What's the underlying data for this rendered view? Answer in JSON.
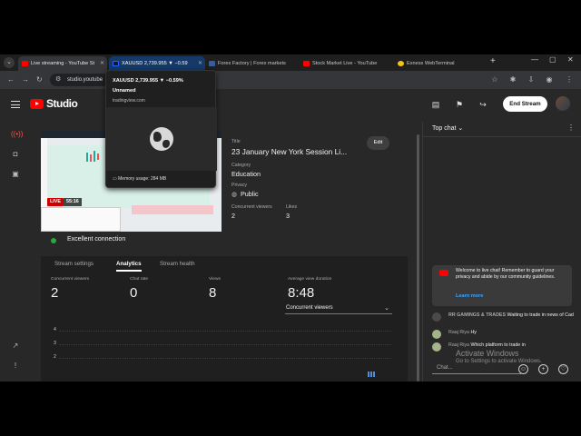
{
  "browser": {
    "tabs": [
      {
        "label": "Live streaming - YouTube St",
        "favicon_color": "#ff0000",
        "state": "active"
      },
      {
        "label": "XAUUSD 2,739.955 ▼ −0.59",
        "favicon_color": "#131722",
        "state": "hovered"
      },
      {
        "label": "Forex Factory | Forex markets",
        "favicon_color": "#3b5b9a",
        "state": "normal"
      },
      {
        "label": "Stock Market Live - YouTube",
        "favicon_color": "#ff0000",
        "state": "normal"
      },
      {
        "label": "Exness WebTerminal",
        "favicon_color": "#f3c316",
        "state": "normal"
      }
    ],
    "url": "studio.youtube",
    "hover_card": {
      "title": "XAUUSD 2,739.955 ▼ −0.59%",
      "subtitle": "Unnamed",
      "domain": "tradingview.com",
      "memory": "Memory usage: 284 MB"
    }
  },
  "studio": {
    "brand": "Studio",
    "end_stream_label": "End Stream",
    "stream": {
      "live_badge": "LIVE",
      "elapsed": "55:16",
      "title_label": "Title",
      "title": "23 January New York Session Li...",
      "edit_label": "Edit",
      "category_label": "Category",
      "category": "Education",
      "privacy_label": "Privacy",
      "privacy": "Public",
      "concurrent_label": "Concurrent viewers",
      "concurrent": "2",
      "likes_label": "Likes",
      "likes": "3",
      "connection": "Excellent connection"
    },
    "tabs": [
      "Stream settings",
      "Analytics",
      "Stream health"
    ],
    "active_tab": "Analytics",
    "analytics": {
      "stats": [
        {
          "label": "Concurrent viewers",
          "value": "2"
        },
        {
          "label": "Chat rate",
          "value": "0"
        },
        {
          "label": "Views",
          "value": "8"
        },
        {
          "label": "Average view duration",
          "value": "8:48"
        }
      ],
      "metric_selector": "Concurrent viewers"
    }
  },
  "chart_data": {
    "type": "bar",
    "title": "",
    "xlabel": "",
    "ylabel": "",
    "y_ticks": [
      "4",
      "3",
      "2"
    ],
    "ylim": [
      2,
      4
    ],
    "series": [
      {
        "values": [
          2,
          2,
          2
        ]
      }
    ],
    "grid": true
  },
  "chat": {
    "title": "Top chat",
    "welcome": "Welcome to live chat! Remember to guard your privacy and abide by our community guidelines.",
    "learn_more": "Learn more",
    "messages": [
      {
        "author": "RR GAMINGS & TRADES",
        "text": "Waiting to trade in news of Cad",
        "avatar_color": "#4a4a4a"
      },
      {
        "author": "Raaj Riya",
        "text": "Hy",
        "avatar_color": "#a3b48a"
      },
      {
        "author": "Raaj Riya",
        "text": "Which platform to trade in",
        "avatar_color": "#a3b48a"
      }
    ],
    "input_placeholder": "Chat...",
    "watermark_title": "Activate Windows",
    "watermark_subtitle": "Go to Settings to activate Windows."
  }
}
